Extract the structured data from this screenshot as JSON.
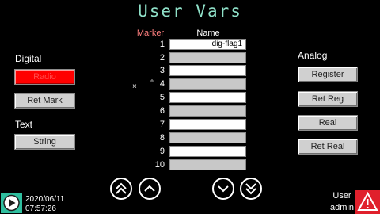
{
  "title": "User Vars",
  "columns": {
    "marker": "Marker",
    "name": "Name"
  },
  "rows": [
    {
      "num": "1",
      "name": "dig-flag1"
    },
    {
      "num": "2",
      "name": ""
    },
    {
      "num": "3",
      "name": ""
    },
    {
      "num": "4",
      "name": ""
    },
    {
      "num": "5",
      "name": ""
    },
    {
      "num": "6",
      "name": ""
    },
    {
      "num": "7",
      "name": ""
    },
    {
      "num": "8",
      "name": ""
    },
    {
      "num": "9",
      "name": ""
    },
    {
      "num": "10",
      "name": ""
    }
  ],
  "stray_marks": {
    "x": "×",
    "dot": "°"
  },
  "digital": {
    "label": "Digital",
    "buttons": [
      {
        "label": "Radio",
        "color": "#ff0000"
      },
      {
        "label": "Ret Mark"
      }
    ]
  },
  "text": {
    "label": "Text",
    "buttons": [
      {
        "label": "String"
      }
    ]
  },
  "analog": {
    "label": "Analog",
    "buttons": [
      {
        "label": "Register"
      },
      {
        "label": "Ret Reg"
      },
      {
        "label": "Real"
      },
      {
        "label": "Ret Real"
      }
    ]
  },
  "nav_icons": [
    "double-chevron-up-icon",
    "chevron-up-icon",
    "chevron-down-icon",
    "double-chevron-down-icon"
  ],
  "status": {
    "date": "2020/06/11",
    "time": "07:57:26",
    "user_label": "User",
    "user_name": "admin"
  },
  "colors": {
    "background": "#000000",
    "title": "#8fe0c8",
    "marker_header": "#ff7f7f",
    "active_button": "#ff0000",
    "play_icon": "#2fbf9f",
    "alarm": "#e0202c"
  }
}
